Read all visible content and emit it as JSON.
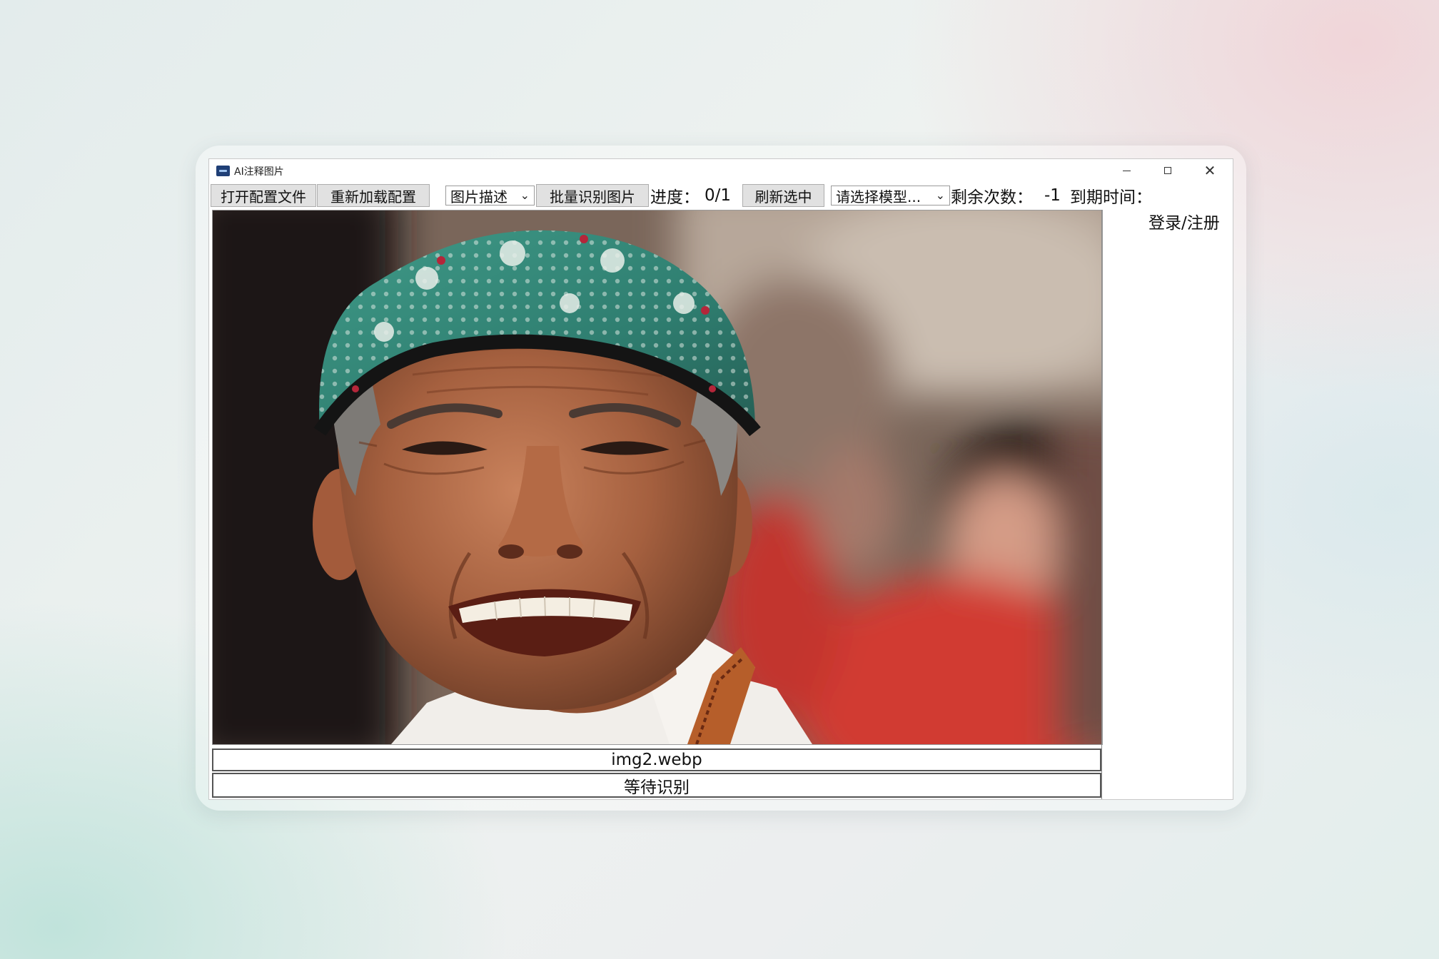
{
  "window": {
    "title": "AI注释图片"
  },
  "toolbar": {
    "open_config_label": "打开配置文件",
    "reload_config_label": "重新加载配置",
    "mode_select_value": "图片描述",
    "batch_recognize_label": "批量识别图片",
    "progress_label": "进度：",
    "progress_value": "0/1",
    "refresh_selected_label": "刷新选中",
    "model_select_value": "请选择模型...",
    "remaining_label": "剩余次数：",
    "remaining_value": "-1",
    "expiry_label": "到期时间："
  },
  "sidebar": {
    "login_label": "登录/注册"
  },
  "preview": {
    "file_name": "img2.webp",
    "status": "等待识别"
  },
  "icons": {
    "app": "app-icon",
    "minimize": "minimize-icon",
    "maximize": "maximize-icon",
    "close": "close-icon",
    "dropdown": "chevron-down-icon"
  }
}
